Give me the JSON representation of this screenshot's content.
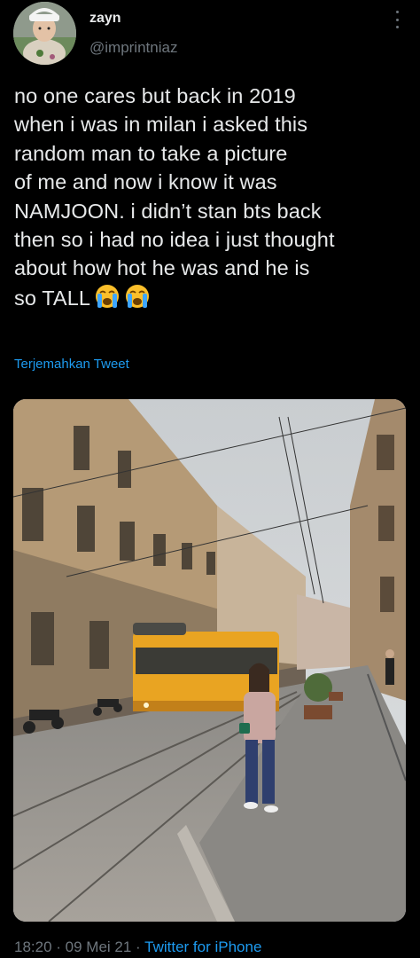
{
  "tweet": {
    "display_name": "zayn",
    "handle": "@imprintniaz",
    "text": "no one cares but back in 2019\nwhen i was in milan i asked this\nrandom man to take a picture\nof me and now i know it was\nNAMJOON. i didn’t stan bts back\nthen so i had no idea i just thought\nabout how hot he was and he is\nso TALL",
    "emoji": [
      "loudly-crying-face-icon",
      "loudly-crying-face-icon"
    ],
    "translate_label": "Terjemahkan Tweet",
    "time": "18:20",
    "separator": " · ",
    "date": "09 Mei 21",
    "source": "Twitter for iPhone"
  },
  "colors": {
    "background": "#000000",
    "text": "#e7e9ea",
    "secondary": "#6e767d",
    "link": "#1d9bf0",
    "tram": "#e9a422"
  }
}
